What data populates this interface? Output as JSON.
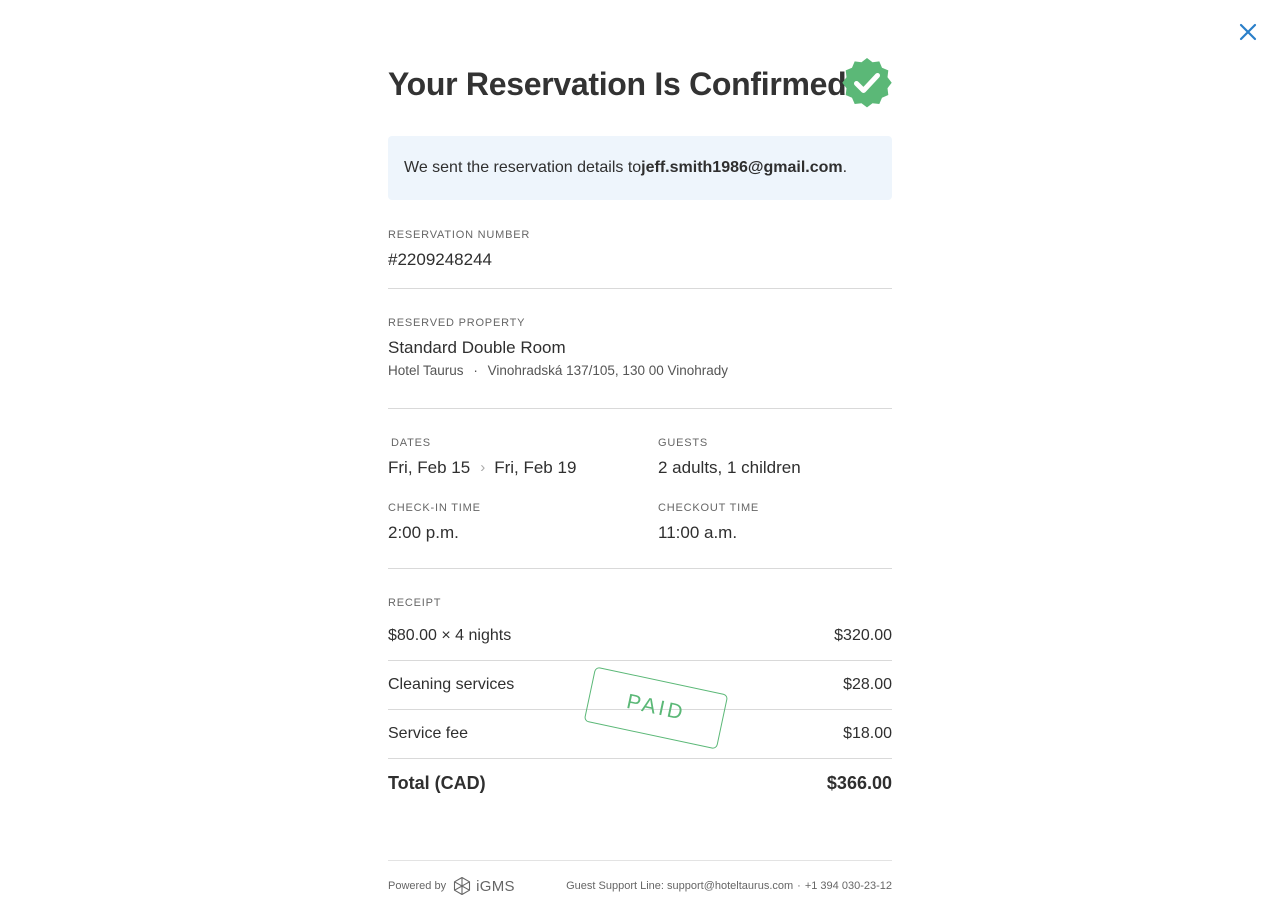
{
  "header": {
    "title": "Your Reservation Is Confirmed",
    "close_icon": "close-icon",
    "badge_icon": "verified-check-badge-icon",
    "accent_color": "#2a7fc9",
    "badge_color": "#5bb877"
  },
  "notice": {
    "prefix": "We sent the reservation details to ",
    "email": "jeff.smith1986@gmail.com",
    "suffix": ".",
    "background": "#eef5fc"
  },
  "reservation": {
    "label": "RESERVATION NUMBER",
    "number": "#2209248244"
  },
  "property": {
    "label": "RESERVED PROPERTY",
    "room": "Standard Double Room",
    "hotel": "Hotel Taurus",
    "separator": "·",
    "address": "Vinohradská 137/105, 130 00 Vinohrady"
  },
  "stay": {
    "dates_label": "DATES",
    "date_from": "Fri, Feb 15",
    "date_to": "Fri, Feb 19",
    "guests_label": "GUESTS",
    "guests": "2 adults, 1 children",
    "checkin_label": "CHECK-IN TIME",
    "checkin": "2:00 p.m.",
    "checkout_label": "CHECKOUT TIME",
    "checkout": "11:00 a.m."
  },
  "receipt": {
    "label": "RECEIPT",
    "items": [
      {
        "label": "$80.00 × 4 nights",
        "amount": "$320.00"
      },
      {
        "label": "Cleaning services",
        "amount": "$28.00"
      },
      {
        "label": "Service fee",
        "amount": "$18.00"
      }
    ],
    "total_label": "Total (CAD)",
    "total_amount": "$366.00",
    "stamp": "PAID",
    "stamp_color": "#5bb877"
  },
  "footer": {
    "powered_by": "Powered by",
    "brand": "iGMS",
    "support_prefix": "Guest Support Line: ",
    "support_email": "support@hoteltaurus.com",
    "separator": "·",
    "support_phone": "+1 394 030-23-12"
  }
}
